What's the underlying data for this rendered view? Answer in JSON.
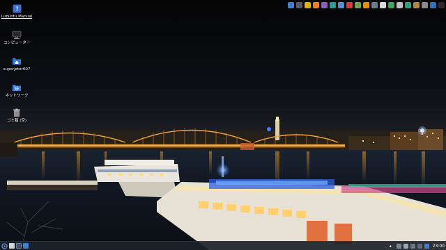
{
  "desktop": {
    "icons": [
      {
        "label": "Lubuntu Manual",
        "icon": "help-manual-icon"
      },
      {
        "label": "コンピューター",
        "icon": "computer-icon"
      },
      {
        "label": "superjeter007",
        "icon": "home-folder-icon"
      },
      {
        "label": "ネットワーク",
        "icon": "network-icon"
      },
      {
        "label": "ゴミ箱 (空)",
        "icon": "trash-icon"
      }
    ]
  },
  "top_launcher": {
    "items": [
      {
        "icon": "file-manager-icon",
        "color": "#3d7fd6"
      },
      {
        "icon": "mail-icon",
        "color": "#5a5a6a"
      },
      {
        "icon": "chrome-icon",
        "color": "#e0b400"
      },
      {
        "icon": "firefox-icon",
        "color": "#ff7a1a"
      },
      {
        "icon": "pidgin-icon",
        "color": "#8a5cc8"
      },
      {
        "icon": "image-viewer-icon",
        "color": "#2a9d8f"
      },
      {
        "icon": "photo-app-icon",
        "color": "#4d8fd6"
      },
      {
        "icon": "media-player-icon",
        "color": "#d93b3b"
      },
      {
        "icon": "torrent-icon",
        "color": "#6aa84f"
      },
      {
        "icon": "vlc-icon",
        "color": "#f08c00"
      },
      {
        "icon": "text-editor-icon",
        "color": "#6b7b8c"
      },
      {
        "icon": "document-icon",
        "color": "#d9d9d9"
      },
      {
        "icon": "spreadsheet-icon",
        "color": "#3aa655"
      },
      {
        "icon": "presentation-icon",
        "color": "#c0c0c0"
      },
      {
        "icon": "shield-icon",
        "color": "#2b9e7a"
      },
      {
        "icon": "archive-icon",
        "color": "#b08a3e"
      },
      {
        "icon": "system-settings-icon",
        "color": "#8a8a8a"
      },
      {
        "icon": "remote-desktop-icon",
        "color": "#2e6fc2"
      },
      {
        "icon": "terminal-icon",
        "color": "#2b2b2b"
      }
    ]
  },
  "taskbar": {
    "clock": "23:00",
    "colors": {
      "bar": "#1c222a",
      "accent": "#3d7fd6"
    }
  }
}
